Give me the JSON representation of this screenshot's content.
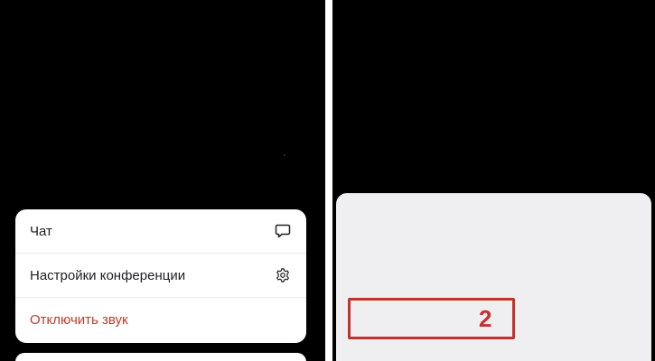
{
  "menu": {
    "items": [
      {
        "label": "Чат",
        "icon": "chat-bubble-icon"
      },
      {
        "label": "Настройки конференции",
        "icon": "gear-icon"
      },
      {
        "label": "Отключить звук",
        "icon": ""
      }
    ]
  },
  "annotation": {
    "step_number": "2",
    "color": "#c8302b"
  },
  "colors": {
    "panel_background": "#000000",
    "sheet_background": "#efeff1",
    "card_background": "#ffffff",
    "danger_text": "#c6362c"
  }
}
